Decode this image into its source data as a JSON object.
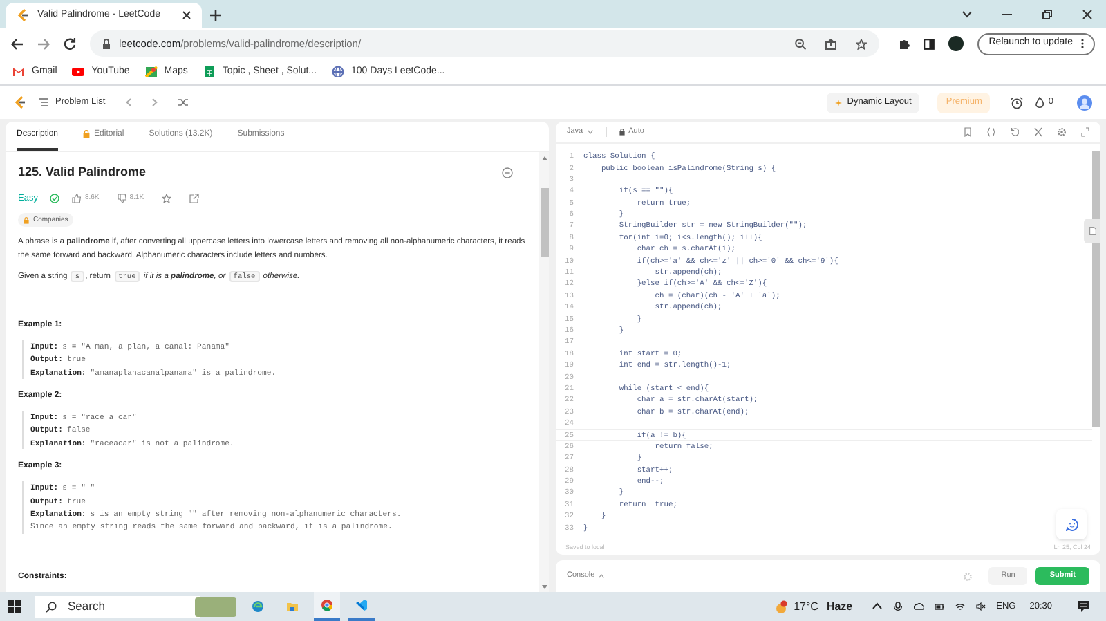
{
  "browser": {
    "tab_title": "Valid Palindrome - LeetCode",
    "url_host": "leetcode.com",
    "url_path": "/problems/valid-palindrome/description/",
    "relaunch": "Relaunch to update",
    "bookmarks": [
      {
        "kind": "gmail",
        "label": "Gmail"
      },
      {
        "kind": "youtube",
        "label": "YouTube"
      },
      {
        "kind": "maps",
        "label": "Maps"
      },
      {
        "kind": "sheet",
        "label": "Topic , Sheet , Solut..."
      },
      {
        "kind": "globe",
        "label": "100 Days LeetCode..."
      }
    ]
  },
  "nav": {
    "problem_list": "Problem List",
    "dynamic_layout": "Dynamic Layout",
    "premium": "Premium",
    "streak": "0"
  },
  "description": {
    "tabs": [
      {
        "label": "Description",
        "selected": true
      },
      {
        "label": "Editorial",
        "selected": false
      },
      {
        "label": "Solutions (13.2K)",
        "selected": false
      },
      {
        "label": "Submissions",
        "selected": false
      }
    ],
    "title": "125. Valid Palindrome",
    "difficulty": "Easy",
    "likes": "8.6K",
    "dislikes": "8.1K",
    "companies": "Companies",
    "paragraph": "A phrase is a **palindrome** if, after converting all uppercase letters into lowercase letters and removing all non-alphanumeric characters, it reads the same forward and backward. Alphanumeric characters include letters and numbers.",
    "statement": [
      {
        "kind": "text",
        "text": "Given a string "
      },
      {
        "kind": "code",
        "text": "s"
      },
      {
        "kind": "text",
        "text": ", return "
      },
      {
        "kind": "code",
        "text": "true"
      },
      {
        "kind": "italic",
        "text": " if it is a "
      },
      {
        "kind": "bold_italic",
        "text": "palindrome"
      },
      {
        "kind": "italic",
        "text": ", or "
      },
      {
        "kind": "code",
        "text": "false"
      },
      {
        "kind": "italic",
        "text": " otherwise."
      }
    ],
    "examples": [
      {
        "title": "Example 1:",
        "lines": [
          {
            "label": "Input:",
            "value": "s = \"A man, a plan, a canal: Panama\""
          },
          {
            "label": "Output:",
            "value": "true"
          },
          {
            "label": "Explanation:",
            "value": "\"amanaplanacanalpanama\" is a palindrome."
          }
        ]
      },
      {
        "title": "Example 2:",
        "lines": [
          {
            "label": "Input:",
            "value": "s = \"race a car\""
          },
          {
            "label": "Output:",
            "value": "false"
          },
          {
            "label": "Explanation:",
            "value": "\"raceacar\" is not a palindrome."
          }
        ]
      },
      {
        "title": "Example 3:",
        "lines": [
          {
            "label": "Input:",
            "value": "s = \" \""
          },
          {
            "label": "Output:",
            "value": "true"
          },
          {
            "label": "Explanation:",
            "value": "s is an empty string \"\" after removing non-alphanumeric characters."
          },
          {
            "value": "Since an empty string reads the same forward and backward, it is a palindrome."
          }
        ]
      }
    ],
    "constraints": "Constraints:"
  },
  "editor": {
    "language": "Java",
    "mode": "Auto",
    "status": "Saved to local",
    "cursor": "Ln 25, Col 24",
    "lines": [
      {
        "no": "1",
        "code": "class Solution {",
        "current": false
      },
      {
        "no": "2",
        "code": "    public boolean isPalindrome(String s) {",
        "current": false
      },
      {
        "no": "3",
        "current": false
      },
      {
        "no": "4",
        "code": "        if(s == \"\"){",
        "current": false
      },
      {
        "no": "5",
        "code": "            return true;",
        "current": false
      },
      {
        "no": "6",
        "code": "        }",
        "current": false
      },
      {
        "no": "7",
        "code": "        StringBuilder str = new StringBuilder(\"\");",
        "current": false
      },
      {
        "no": "8",
        "code": "        for(int i=0; i<s.length(); i++){",
        "current": false
      },
      {
        "no": "9",
        "code": "            char ch = s.charAt(i);",
        "current": false
      },
      {
        "no": "10",
        "code": "            if(ch>='a' && ch<='z' || ch>='0' && ch<='9'){",
        "current": false
      },
      {
        "no": "11",
        "code": "                str.append(ch);",
        "current": false
      },
      {
        "no": "12",
        "code": "            }else if(ch>='A' && ch<='Z'){",
        "current": false
      },
      {
        "no": "13",
        "code": "                ch = (char)(ch - 'A' + 'a');",
        "current": false
      },
      {
        "no": "14",
        "code": "                str.append(ch);",
        "current": false
      },
      {
        "no": "15",
        "code": "            }",
        "current": false
      },
      {
        "no": "16",
        "code": "        }",
        "current": false
      },
      {
        "no": "17",
        "current": false
      },
      {
        "no": "18",
        "code": "        int start = 0;",
        "current": false
      },
      {
        "no": "19",
        "code": "        int end = str.length()-1;",
        "current": false
      },
      {
        "no": "20",
        "current": false
      },
      {
        "no": "21",
        "code": "        while (start < end){",
        "current": false
      },
      {
        "no": "22",
        "code": "            char a = str.charAt(start);",
        "current": false
      },
      {
        "no": "23",
        "code": "            char b = str.charAt(end);",
        "current": false
      },
      {
        "no": "24",
        "current": false
      },
      {
        "no": "25",
        "code": "            if(a != b){",
        "current": true
      },
      {
        "no": "26",
        "code": "                return false;",
        "current": false
      },
      {
        "no": "27",
        "code": "            }",
        "current": false
      },
      {
        "no": "28",
        "code": "            start++;",
        "current": false
      },
      {
        "no": "29",
        "code": "            end--;",
        "current": false
      },
      {
        "no": "30",
        "code": "        }",
        "current": false
      },
      {
        "no": "31",
        "code": "        return  true;",
        "current": false
      },
      {
        "no": "32",
        "code": "    }",
        "current": false
      },
      {
        "no": "33",
        "code": "}",
        "current": false
      }
    ]
  },
  "console": {
    "label": "Console",
    "run": "Run",
    "submit": "Submit"
  },
  "taskbar": {
    "search": "Search",
    "temperature": "17°C",
    "weather": "Haze",
    "language": "ENG",
    "time": "20:30"
  }
}
